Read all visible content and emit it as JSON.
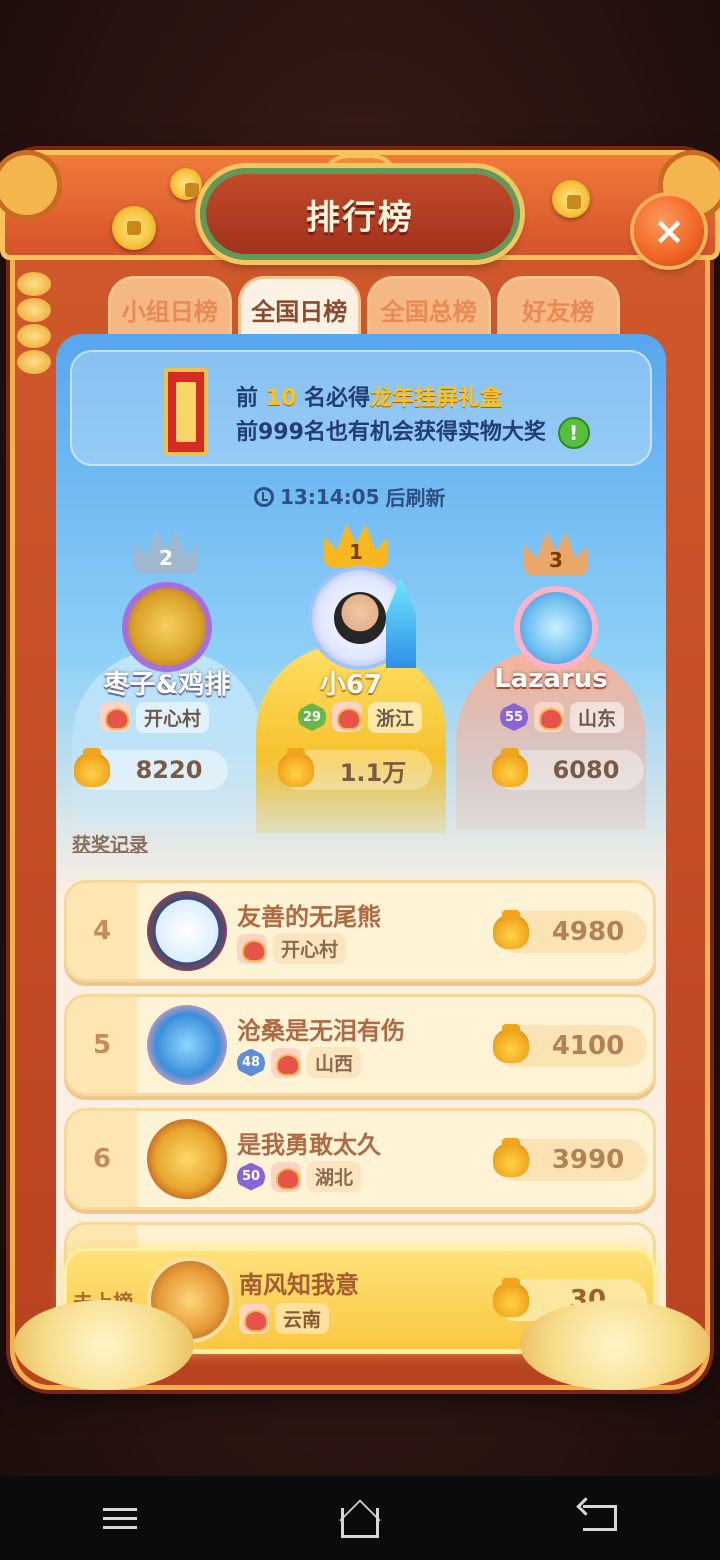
{
  "title": "排行榜",
  "close_label": "×",
  "tabs": [
    {
      "label": "小组日榜",
      "active": false
    },
    {
      "label": "全国日榜",
      "active": true
    },
    {
      "label": "全国总榜",
      "active": false
    },
    {
      "label": "好友榜",
      "active": false
    }
  ],
  "banner": {
    "line1_prefix": "前",
    "line1_count": "10",
    "line1_middle": "名必得",
    "line1_prize": "龙年挂屏礼盒",
    "line2": "前999名也有机会获得实物大奖",
    "info_icon": "!"
  },
  "refresh": {
    "time": "13:14:05",
    "suffix": "后刷新"
  },
  "podium": {
    "first": {
      "rank": "1",
      "name": "小67",
      "level": "29",
      "region": "浙江",
      "score": "1.1万"
    },
    "second": {
      "rank": "2",
      "name": "枣子&鸡排",
      "region": "开心村",
      "score": "8220"
    },
    "third": {
      "rank": "3",
      "name": "Lazarus",
      "level": "55",
      "region": "山东",
      "score": "6080"
    }
  },
  "award_link": "获奖记录",
  "rows": [
    {
      "rank": "4",
      "name": "友善的无尾熊",
      "region": "开心村",
      "score": "4980"
    },
    {
      "rank": "5",
      "name": "沧桑是无泪有伤",
      "level": "48",
      "region": "山西",
      "score": "4100"
    },
    {
      "rank": "6",
      "name": "是我勇敢太久",
      "level": "50",
      "region": "湖北",
      "score": "3990"
    }
  ],
  "mine": {
    "rank": "未上榜",
    "name": "南风知我意",
    "region": "云南",
    "score": "30"
  },
  "colors": {
    "frame": "#c84a22",
    "accent_gold": "#ffc419",
    "panel_blue": "#57a6ee",
    "row_bg": "#fff3d6"
  }
}
